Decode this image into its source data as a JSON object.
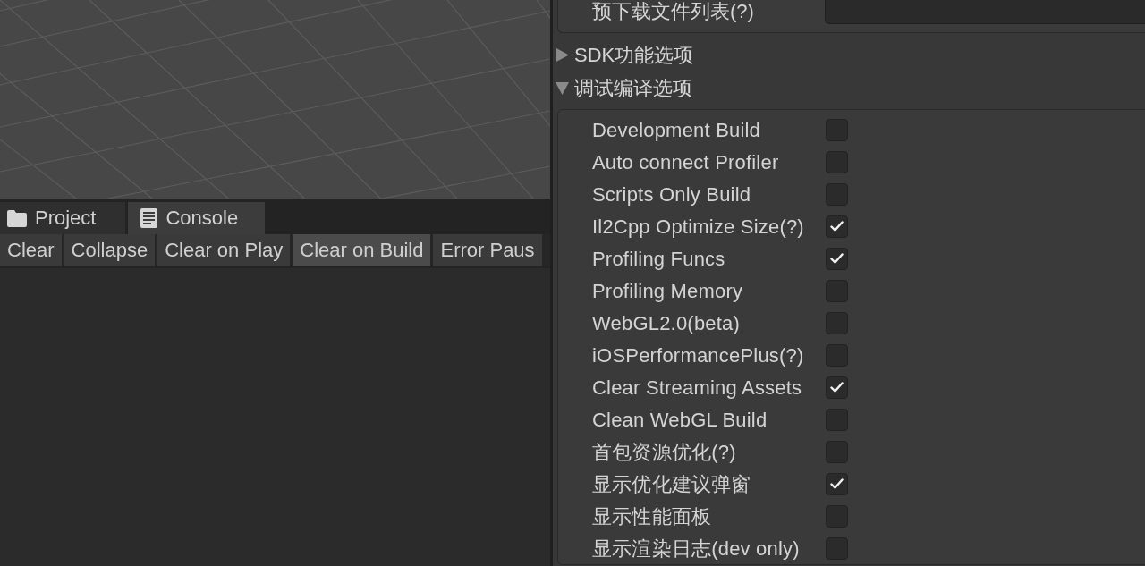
{
  "tabs": [
    {
      "kind": "project",
      "label": "Project",
      "selected": false
    },
    {
      "kind": "console",
      "label": "Console",
      "selected": true
    }
  ],
  "console_toolbar": [
    {
      "label": "Clear",
      "on": false
    },
    {
      "label": "Collapse",
      "on": false
    },
    {
      "label": "Clear on Play",
      "on": false
    },
    {
      "label": "Clear on Build",
      "on": true
    },
    {
      "label": "Error Paus",
      "on": false
    }
  ],
  "inspector": {
    "field": {
      "label": "预下载文件列表(?)"
    },
    "foldouts": [
      {
        "label": "SDK功能选项",
        "expanded": false
      },
      {
        "label": "调试编译选项",
        "expanded": true,
        "options": [
          {
            "label": "Development Build",
            "checked": false
          },
          {
            "label": "Auto connect Profiler",
            "checked": false
          },
          {
            "label": "Scripts Only Build",
            "checked": false
          },
          {
            "label": "Il2Cpp Optimize Size(?)",
            "checked": true
          },
          {
            "label": "Profiling Funcs",
            "checked": true
          },
          {
            "label": "Profiling Memory",
            "checked": false
          },
          {
            "label": "WebGL2.0(beta)",
            "checked": false
          },
          {
            "label": "iOSPerformancePlus(?)",
            "checked": false
          },
          {
            "label": "Clear Streaming Assets",
            "checked": true
          },
          {
            "label": "Clean WebGL Build",
            "checked": false
          },
          {
            "label": "首包资源优化(?)",
            "checked": false
          },
          {
            "label": "显示优化建议弹窗",
            "checked": true
          },
          {
            "label": "显示性能面板",
            "checked": false
          },
          {
            "label": "显示渲染日志(dev only)",
            "checked": false
          }
        ]
      }
    ]
  }
}
